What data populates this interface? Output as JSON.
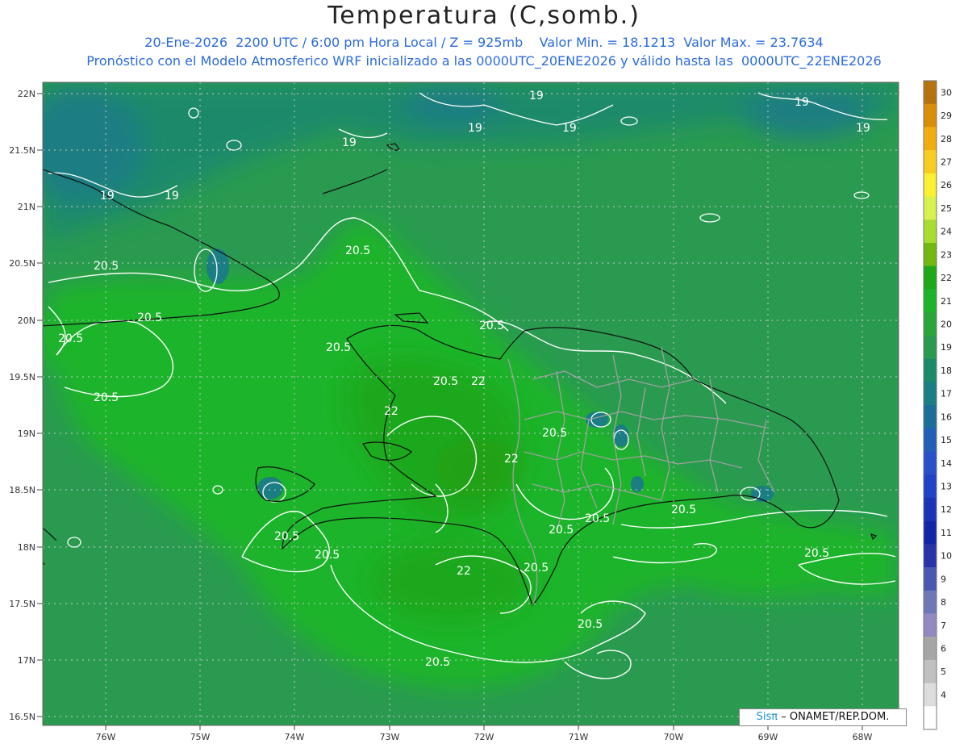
{
  "header": {
    "title": "Temperatura (C,somb.)",
    "line1": "20-Ene-2026  2200 UTC / 6:00 pm Hora Local / Z = 925mb    Valor Min. = 18.1213  Valor Max. = 23.7634",
    "line2": "Pronóstico con el Modelo Atmosferico WRF inicializado a las 0000UTC_20ENE2026 y válido hasta las  0000UTC_22ENE2026"
  },
  "axes": {
    "lat_labels": [
      "22N",
      "21.5N",
      "21N",
      "20.5N",
      "20N",
      "19.5N",
      "19N",
      "18.5N",
      "18N",
      "17.5N",
      "17N",
      "16.5N"
    ],
    "lon_labels": [
      "76W",
      "75W",
      "74W",
      "73W",
      "72W",
      "71W",
      "70W",
      "69W",
      "68W"
    ]
  },
  "colorbar": {
    "labels": [
      "30",
      "29",
      "28",
      "27",
      "26",
      "25",
      "24",
      "23",
      "22",
      "21",
      "20",
      "19",
      "18",
      "17",
      "16",
      "15",
      "14",
      "13",
      "12",
      "11",
      "10",
      "9",
      "8",
      "7",
      "6",
      "5",
      "4"
    ],
    "colors": [
      "#b5720e",
      "#d98e0a",
      "#f0ad10",
      "#f8cc20",
      "#f8f030",
      "#d8f050",
      "#a8dc30",
      "#72b810",
      "#1ea81a",
      "#1cb42a",
      "#2aa53a",
      "#2a9a50",
      "#1a8a6a",
      "#1a7e82",
      "#1c6e9a",
      "#2260b8",
      "#2850c8",
      "#2042c8",
      "#1a34b8",
      "#1424a8",
      "#2a32a8",
      "#4a58b0",
      "#6e78b8",
      "#9488c0",
      "#a6a6a6",
      "#c0c0c0",
      "#dcdcdc",
      "#ffffff"
    ]
  },
  "contours": {
    "labels_19": [
      "19",
      "19",
      "19",
      "19",
      "19",
      "19",
      "19",
      "19"
    ],
    "labels_20_5": [
      "20.5",
      "20.5",
      "20.5",
      "20.5",
      "20.5",
      "20.5",
      "20.5",
      "20.5",
      "20.5",
      "20.5",
      "20.5",
      "20.5",
      "20.5",
      "20.5",
      "20.5",
      "20.5",
      "20.5",
      "20.5"
    ],
    "labels_22": [
      "22",
      "22",
      "22",
      "22"
    ]
  },
  "credit": {
    "brand": "Sisπ",
    "text": "– ONAMET/REP.DOM."
  }
}
